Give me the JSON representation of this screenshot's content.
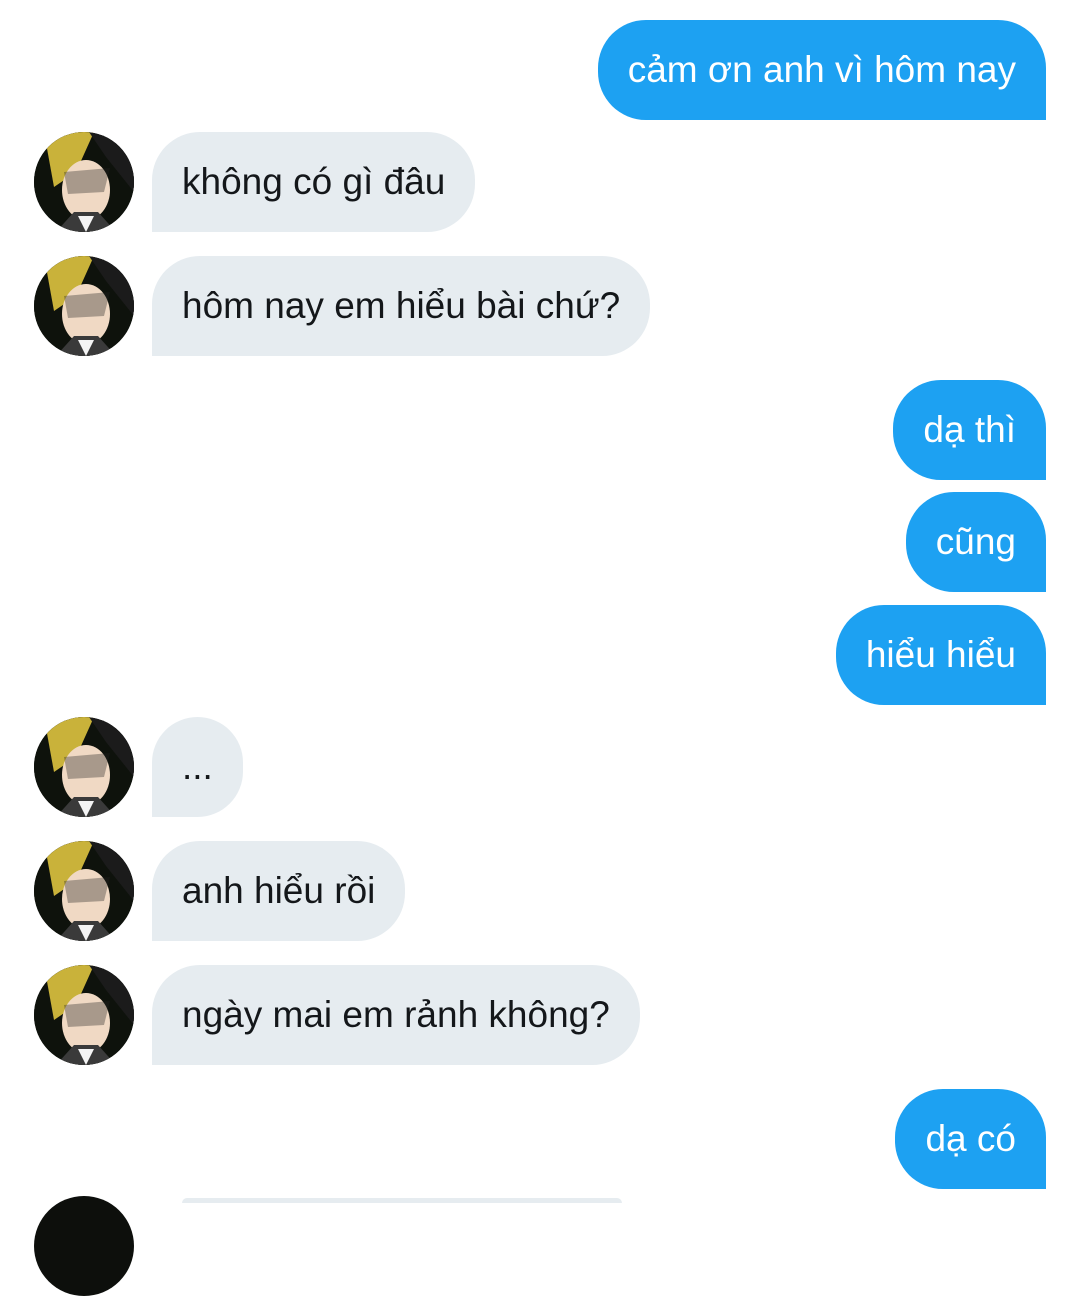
{
  "conversation": {
    "messages": [
      {
        "side": "outgoing",
        "text": "cảm ơn anh vì hôm nay"
      },
      {
        "side": "incoming",
        "text": "không có gì đâu"
      },
      {
        "side": "incoming",
        "text": "hôm nay em hiểu bài chứ?"
      },
      {
        "side": "outgoing",
        "text": "dạ thì"
      },
      {
        "side": "outgoing",
        "text": "cũng"
      },
      {
        "side": "outgoing",
        "text": "hiểu hiểu"
      },
      {
        "side": "incoming",
        "text": "..."
      },
      {
        "side": "incoming",
        "text": "anh hiểu rồi"
      },
      {
        "side": "incoming",
        "text": "ngày mai em rảnh không?"
      },
      {
        "side": "outgoing",
        "text": "dạ có"
      }
    ]
  },
  "contact": {
    "avatar_icon": "anime-character-avatar"
  },
  "colors": {
    "outgoing_bubble": "#1da1f2",
    "incoming_bubble": "#e6ecf0",
    "incoming_text": "#14171a",
    "outgoing_text": "#ffffff"
  }
}
